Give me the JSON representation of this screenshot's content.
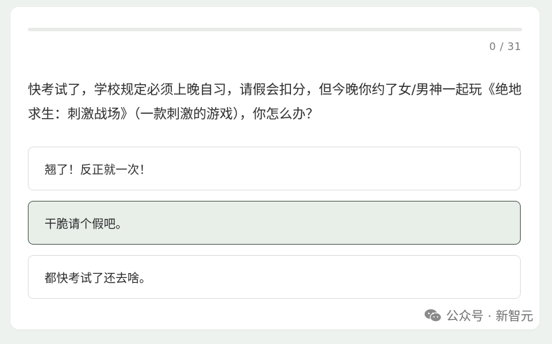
{
  "quiz": {
    "progress_counter": "0 / 31",
    "progress_fraction": 0,
    "question": "快考试了，学校规定必须上晚自习，请假会扣分，但今晚你约了女/男神一起玩《绝地求生：刺激战场》（一款刺激的游戏），你怎么办？",
    "options": [
      {
        "label": "翘了！反正就一次！",
        "selected": false
      },
      {
        "label": "干脆请个假吧。",
        "selected": true
      },
      {
        "label": "都快考试了还去啥。",
        "selected": false
      }
    ]
  },
  "watermark": {
    "icon": "wechat-icon",
    "text": "公众号 · 新智元"
  },
  "colors": {
    "page_background": "#eef2ee",
    "selected_option_background": "#e8efe9",
    "selected_option_border": "#4d5a50",
    "progress_track": "#e8ebe8"
  }
}
